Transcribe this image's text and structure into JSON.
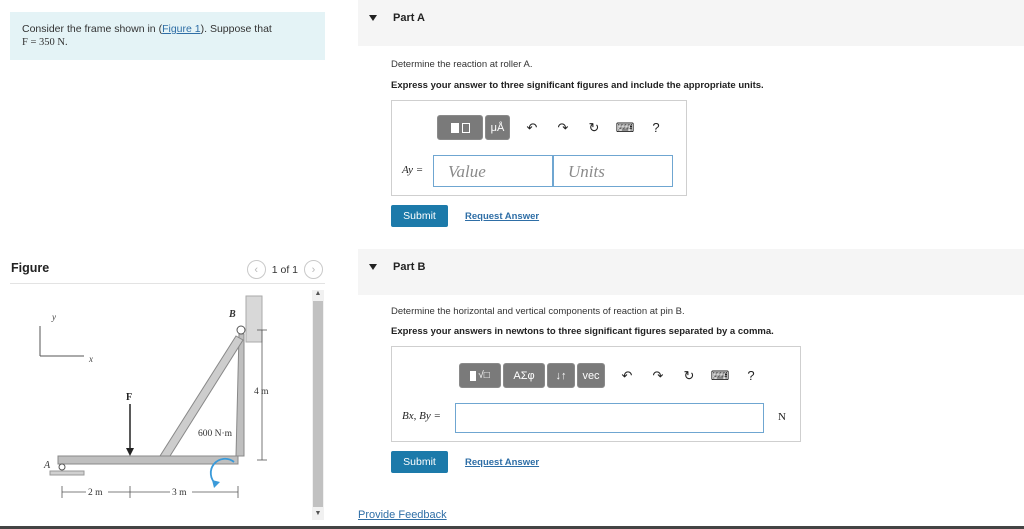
{
  "problem": {
    "text_before_link": "Consider the frame shown in (",
    "link": "Figure 1",
    "text_after_link": "). Suppose that",
    "force_line": "F = 350 N."
  },
  "figure": {
    "title": "Figure",
    "pager": "1 of 1",
    "prev_icon": "chevron-left-icon",
    "next_icon": "chevron-right-icon",
    "labels": {
      "y": "y",
      "x": "x",
      "B": "B",
      "A": "A",
      "F": "F",
      "moment": "600 N·m",
      "height": "4 m",
      "dist1": "2 m",
      "dist2": "3 m"
    }
  },
  "partA": {
    "title": "Part A",
    "instruction": "Determine the reaction at roller A.",
    "instruction_bold": "Express your answer to three significant figures and include the appropriate units.",
    "toolbar": {
      "templates_icon": "templates-icon",
      "units_button": "μÅ",
      "undo_icon": "undo-icon",
      "redo_icon": "redo-icon",
      "reset_icon": "reset-icon",
      "keyboard_icon": "keyboard-icon",
      "help": "?"
    },
    "eq_label": "Ay =",
    "value_placeholder": "Value",
    "units_placeholder": "Units",
    "submit": "Submit",
    "request": "Request Answer"
  },
  "partB": {
    "title": "Part B",
    "instruction": "Determine the horizontal and vertical components of reaction at pin B.",
    "instruction_bold": "Express your answers in newtons to three significant figures separated by a comma.",
    "toolbar": {
      "templates_icon": "templates-icon",
      "greek_button": "ΑΣφ",
      "arrows_button": "↓↑",
      "vec_button": "vec",
      "undo_icon": "undo-icon",
      "redo_icon": "redo-icon",
      "reset_icon": "reset-icon",
      "keyboard_icon": "keyboard-icon",
      "help": "?"
    },
    "eq_label": "Bx, By =",
    "unit": "N",
    "submit": "Submit",
    "request": "Request Answer"
  },
  "feedback": "Provide Feedback",
  "colors": {
    "accent": "#1c7aaa",
    "link": "#2e6ea6",
    "problem_bg": "#e4f3f6"
  }
}
